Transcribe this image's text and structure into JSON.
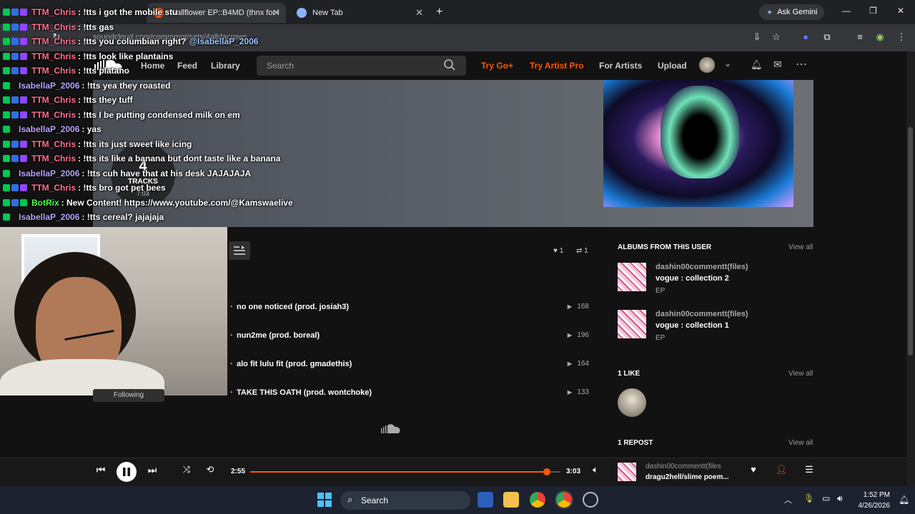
{
  "browser": {
    "tabs": [
      {
        "title": "Wallflower EP::B4MD (thnx for l"
      },
      {
        "title": "New Tab"
      }
    ],
    "gemini_label": "Ask Gemini",
    "url": "soundcloud.com/commmnt/sets/4alldacrows"
  },
  "header": {
    "nav": [
      "Home",
      "Feed",
      "Library"
    ],
    "search_placeholder": "Search",
    "try_go": "Try Go+",
    "try_artist": "Try Artist Pro",
    "for_artists": "For Artists",
    "upload": "Upload"
  },
  "hero": {
    "track_count": "4",
    "track_label": "TRACKS",
    "duration": "7:03"
  },
  "chat": [
    {
      "user": "TTM_Chris",
      "kind": "chris",
      "text": ": !tts i got the mobile stu"
    },
    {
      "user": "TTM_Chris",
      "kind": "chris",
      "text": ": !tts gas"
    },
    {
      "user": "TTM_Chris",
      "kind": "chris",
      "text": ": !tts you columbian right?",
      "mention": "@IsabellaP_2006"
    },
    {
      "user": "TTM_Chris",
      "kind": "chris",
      "text": ": !tts look like plantains"
    },
    {
      "user": "TTM_Chris",
      "kind": "chris",
      "text": ": !tts platano"
    },
    {
      "user": "IsabellaP_2006",
      "kind": "bella",
      "text": ": !tts yea they roasted"
    },
    {
      "user": "TTM_Chris",
      "kind": "chris",
      "text": ": !tts they tuff"
    },
    {
      "user": "TTM_Chris",
      "kind": "chris",
      "text": ": !tts I be putting condensed milk on em"
    },
    {
      "user": "IsabellaP_2006",
      "kind": "bella",
      "text": ": yas"
    },
    {
      "user": "TTM_Chris",
      "kind": "chris",
      "text": ": !tts its just sweet like icing"
    },
    {
      "user": "TTM_Chris",
      "kind": "chris",
      "text": ": !tts its like a banana but dont taste like a banana"
    },
    {
      "user": "IsabellaP_2006",
      "kind": "bella",
      "text": ": !tts cuh have that at his desk JAJAJAJA"
    },
    {
      "user": "TTM_Chris",
      "kind": "chris",
      "text": ": !tts bro got pet bees"
    },
    {
      "user": "BotRix",
      "kind": "bot",
      "text": ": New Content! https://www.youtube.com/@Kamswaelive"
    },
    {
      "user": "IsabellaP_2006",
      "kind": "bella",
      "text": ": !tts cereal? jajajaja"
    }
  ],
  "stats": {
    "likes": "1",
    "reposts": "1"
  },
  "tracks": [
    {
      "title": "no one noticed (prod. josiah3)",
      "plays": "168"
    },
    {
      "title": "nun2me (prod. boreal)",
      "plays": "196"
    },
    {
      "title": "alo fit lulu fit (prod. gmadethis)",
      "plays": "164"
    },
    {
      "title": "TAKE THIS OATH (prod. wontchoke)",
      "plays": "133"
    }
  ],
  "following_label": "Following",
  "sidebar": {
    "albums_heading": "ALBUMS FROM THIS USER",
    "view_all": "View all",
    "albums": [
      {
        "user": "dashin00commentt(files)",
        "title": "vogue : collection 2",
        "type": "EP"
      },
      {
        "user": "dashin00commentt(files)",
        "title": "vogue : collection 1",
        "type": "EP"
      }
    ],
    "likes_heading": "1 LIKE",
    "reposts_heading": "1 REPOST"
  },
  "player": {
    "current": "2:55",
    "total": "3:03",
    "progress": 0.956,
    "np_user": "dashin00commentt(files",
    "np_title": "dragu2hell/slime poem..."
  },
  "taskbar": {
    "search": "Search",
    "time": "1:52 PM",
    "date": "4/26/2026"
  },
  "colors": {
    "accent": "#ff5500",
    "chris": "#ff6f91",
    "bella": "#b7a4ff",
    "bot": "#4cff4c"
  }
}
